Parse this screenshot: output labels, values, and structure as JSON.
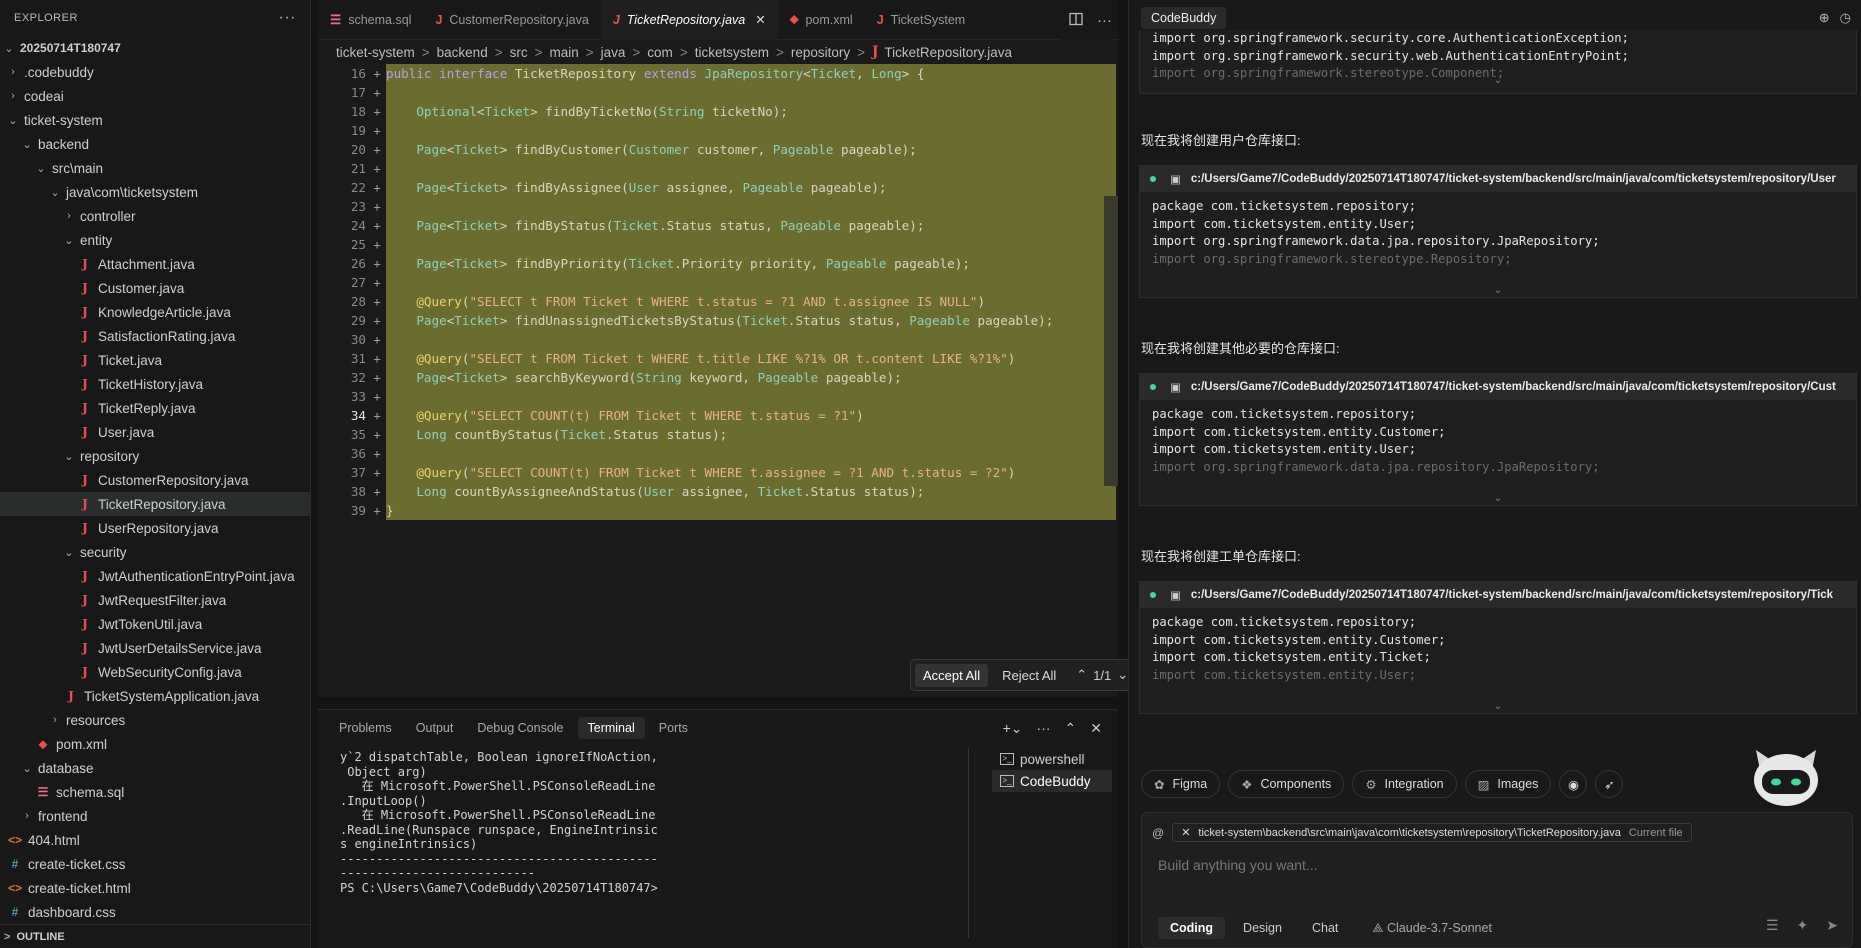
{
  "explorer": {
    "title": "EXPLORER",
    "more": "···",
    "outline_label": "OUTLINE",
    "items": [
      {
        "label": "20250714T180747",
        "depth": 0,
        "kind": "root",
        "chev": "∨"
      },
      {
        "label": ".codebuddy",
        "depth": 1,
        "kind": "folder",
        "chev": ">"
      },
      {
        "label": "codeai",
        "depth": 1,
        "kind": "folder",
        "chev": ">"
      },
      {
        "label": "ticket-system",
        "depth": 1,
        "kind": "folder",
        "chev": "∨"
      },
      {
        "label": "backend",
        "depth": 2,
        "kind": "folder",
        "chev": "∨"
      },
      {
        "label": "src\\main",
        "depth": 3,
        "kind": "folder",
        "chev": "∨"
      },
      {
        "label": "java\\com\\ticketsystem",
        "depth": 4,
        "kind": "folder",
        "chev": "∨"
      },
      {
        "label": "controller",
        "depth": 5,
        "kind": "folder",
        "chev": ">"
      },
      {
        "label": "entity",
        "depth": 5,
        "kind": "folder",
        "chev": "∨"
      },
      {
        "label": "Attachment.java",
        "depth": 6,
        "kind": "java"
      },
      {
        "label": "Customer.java",
        "depth": 6,
        "kind": "java"
      },
      {
        "label": "KnowledgeArticle.java",
        "depth": 6,
        "kind": "java"
      },
      {
        "label": "SatisfactionRating.java",
        "depth": 6,
        "kind": "java"
      },
      {
        "label": "Ticket.java",
        "depth": 6,
        "kind": "java"
      },
      {
        "label": "TicketHistory.java",
        "depth": 6,
        "kind": "java"
      },
      {
        "label": "TicketReply.java",
        "depth": 6,
        "kind": "java"
      },
      {
        "label": "User.java",
        "depth": 6,
        "kind": "java"
      },
      {
        "label": "repository",
        "depth": 5,
        "kind": "folder",
        "chev": "∨"
      },
      {
        "label": "CustomerRepository.java",
        "depth": 6,
        "kind": "java"
      },
      {
        "label": "TicketRepository.java",
        "depth": 6,
        "kind": "java",
        "selected": true
      },
      {
        "label": "UserRepository.java",
        "depth": 6,
        "kind": "java"
      },
      {
        "label": "security",
        "depth": 5,
        "kind": "folder",
        "chev": "∨"
      },
      {
        "label": "JwtAuthenticationEntryPoint.java",
        "depth": 6,
        "kind": "java"
      },
      {
        "label": "JwtRequestFilter.java",
        "depth": 6,
        "kind": "java"
      },
      {
        "label": "JwtTokenUtil.java",
        "depth": 6,
        "kind": "java"
      },
      {
        "label": "JwtUserDetailsService.java",
        "depth": 6,
        "kind": "java"
      },
      {
        "label": "WebSecurityConfig.java",
        "depth": 6,
        "kind": "java"
      },
      {
        "label": "TicketSystemApplication.java",
        "depth": 5,
        "kind": "java"
      },
      {
        "label": "resources",
        "depth": 4,
        "kind": "folder",
        "chev": ">"
      },
      {
        "label": "pom.xml",
        "depth": 3,
        "kind": "xml"
      },
      {
        "label": "database",
        "depth": 2,
        "kind": "folder",
        "chev": "∨"
      },
      {
        "label": "schema.sql",
        "depth": 3,
        "kind": "sql"
      },
      {
        "label": "frontend",
        "depth": 2,
        "kind": "folder",
        "chev": ">"
      },
      {
        "label": "404.html",
        "depth": 1,
        "kind": "html"
      },
      {
        "label": "create-ticket.css",
        "depth": 1,
        "kind": "css"
      },
      {
        "label": "create-ticket.html",
        "depth": 1,
        "kind": "html"
      },
      {
        "label": "dashboard.css",
        "depth": 1,
        "kind": "css"
      }
    ]
  },
  "editor": {
    "tabs": [
      {
        "label": "schema.sql",
        "icon": "sql-icon",
        "glyph": "☰"
      },
      {
        "label": "CustomerRepository.java",
        "icon": "java-icon",
        "glyph": "J"
      },
      {
        "label": "TicketRepository.java",
        "icon": "java-icon",
        "glyph": "J",
        "active": true
      },
      {
        "label": "pom.xml",
        "icon": "xml-icon",
        "glyph": "⬥"
      },
      {
        "label": "TicketSystem",
        "icon": "java-icon",
        "glyph": "J"
      }
    ],
    "breadcrumb": [
      "ticket-system",
      "backend",
      "src",
      "main",
      "java",
      "com",
      "ticketsystem",
      "repository",
      "TicketRepository.java"
    ],
    "code_lines": [
      {
        "n": "16",
        "text": "public interface TicketRepository extends JpaRepository<Ticket, Long> {"
      },
      {
        "n": "17",
        "text": ""
      },
      {
        "n": "18",
        "text": "    Optional<Ticket> findByTicketNo(String ticketNo);"
      },
      {
        "n": "19",
        "text": ""
      },
      {
        "n": "20",
        "text": "    Page<Ticket> findByCustomer(Customer customer, Pageable pageable);"
      },
      {
        "n": "21",
        "text": ""
      },
      {
        "n": "22",
        "text": "    Page<Ticket> findByAssignee(User assignee, Pageable pageable);"
      },
      {
        "n": "23",
        "text": ""
      },
      {
        "n": "24",
        "text": "    Page<Ticket> findByStatus(Ticket.Status status, Pageable pageable);"
      },
      {
        "n": "25",
        "text": ""
      },
      {
        "n": "26",
        "text": "    Page<Ticket> findByPriority(Ticket.Priority priority, Pageable pageable);"
      },
      {
        "n": "27",
        "text": ""
      },
      {
        "n": "28",
        "text": "    @Query(\"SELECT t FROM Ticket t WHERE t.status = ?1 AND t.assignee IS NULL\")"
      },
      {
        "n": "29",
        "text": "    Page<Ticket> findUnassignedTicketsByStatus(Ticket.Status status, Pageable pageable);"
      },
      {
        "n": "30",
        "text": ""
      },
      {
        "n": "31",
        "text": "    @Query(\"SELECT t FROM Ticket t WHERE t.title LIKE %?1% OR t.content LIKE %?1%\")"
      },
      {
        "n": "32",
        "text": "    Page<Ticket> searchByKeyword(String keyword, Pageable pageable);"
      },
      {
        "n": "33",
        "text": ""
      },
      {
        "n": "34",
        "text": "    @Query(\"SELECT COUNT(t) FROM Ticket t WHERE t.status = ?1\")",
        "current": true
      },
      {
        "n": "35",
        "text": "    Long countByStatus(Ticket.Status status);"
      },
      {
        "n": "36",
        "text": ""
      },
      {
        "n": "37",
        "text": "    @Query(\"SELECT COUNT(t) FROM Ticket t WHERE t.assignee = ?1 AND t.status = ?2\")"
      },
      {
        "n": "38",
        "text": "    Long countByAssigneeAndStatus(User assignee, Ticket.Status status);"
      },
      {
        "n": "39",
        "text": "}"
      }
    ],
    "diff_bar": {
      "accept": "Accept All",
      "reject": "Reject All",
      "counter": "1/1"
    }
  },
  "panel": {
    "tabs": [
      "Problems",
      "Output",
      "Debug Console",
      "Terminal",
      "Ports"
    ],
    "active_tab": "Terminal",
    "terminal_text": "y`2 dispatchTable, Boolean ignoreIfNoAction,\n Object arg)\n   在 Microsoft.PowerShell.PSConsoleReadLine\n.InputLoop()\n   在 Microsoft.PowerShell.PSConsoleReadLine\n.ReadLine(Runspace runspace, EngineIntrinsic\ns engineIntrinsics)\n--------------------------------------------\n---------------------------\nPS C:\\Users\\Game7\\CodeBuddy\\20250714T180747>",
    "terminals": [
      {
        "label": "powershell"
      },
      {
        "label": "CodeBuddy",
        "active": true
      }
    ]
  },
  "buddy": {
    "title": "CodeBuddy",
    "top_block_lines": [
      "import org.springframework.security.core.AuthenticationException;",
      "import org.springframework.security.web.AuthenticationEntryPoint;",
      "import org.springframework.stereotype.Component;"
    ],
    "blocks": [
      {
        "message": "现在我将创建用户仓库接口:",
        "path": "c:/Users/Game7/CodeBuddy/20250714T180747/ticket-system/backend/src/main/java/com/ticketsystem/repository/User",
        "lines": [
          "package com.ticketsystem.repository;",
          "",
          "import com.ticketsystem.entity.User;",
          "import org.springframework.data.jpa.repository.JpaRepository;",
          "import org.springframework.stereotype.Repository;"
        ]
      },
      {
        "message": "现在我将创建其他必要的仓库接口:",
        "path": "c:/Users/Game7/CodeBuddy/20250714T180747/ticket-system/backend/src/main/java/com/ticketsystem/repository/Cust",
        "lines": [
          "package com.ticketsystem.repository;",
          "",
          "import com.ticketsystem.entity.Customer;",
          "import com.ticketsystem.entity.User;",
          "import org.springframework.data.jpa.repository.JpaRepository;"
        ]
      },
      {
        "message": "现在我将创建工单仓库接口:",
        "path": "c:/Users/Game7/CodeBuddy/20250714T180747/ticket-system/backend/src/main/java/com/ticketsystem/repository/Tick",
        "lines": [
          "package com.ticketsystem.repository;",
          "",
          "import com.ticketsystem.entity.Customer;",
          "import com.ticketsystem.entity.Ticket;",
          "import com.ticketsystem.entity.User;"
        ]
      }
    ],
    "chips": [
      "Figma",
      "Components",
      "Integration",
      "Images"
    ],
    "context_file": "ticket-system\\backend\\src\\main\\java\\com\\ticketsystem\\repository\\TicketRepository.java",
    "context_tag": "Current file",
    "placeholder": "Build anything you want...",
    "modes": [
      "Coding",
      "Design",
      "Chat"
    ],
    "active_mode": "Coding",
    "model": "Claude-3.7-Sonnet"
  }
}
